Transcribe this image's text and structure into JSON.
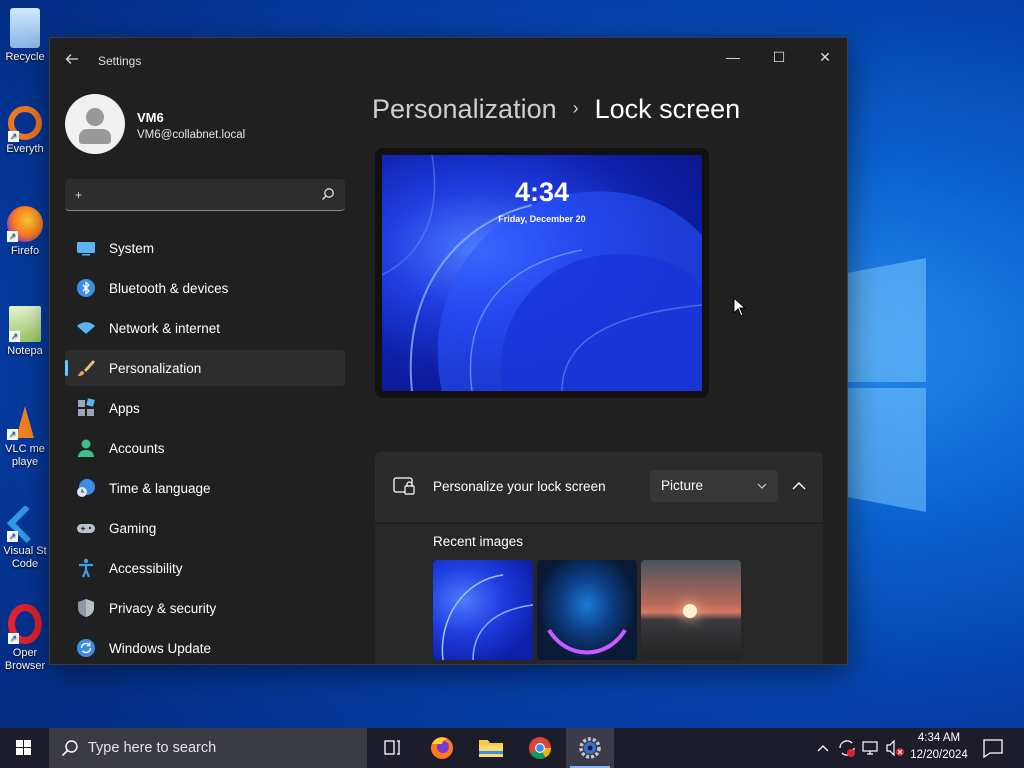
{
  "desktop": {
    "icons": [
      {
        "label": "Recycle"
      },
      {
        "label": "Everyth"
      },
      {
        "label": "Firefo"
      },
      {
        "label": "Notepa"
      },
      {
        "label": "VLC me"
      },
      {
        "label": "playe"
      },
      {
        "label": "Visual St"
      },
      {
        "label": "Code"
      },
      {
        "label": "Oper"
      },
      {
        "label": "Browser"
      }
    ]
  },
  "window": {
    "title": "Settings",
    "controls": {
      "minimize": "—",
      "maximize": "☐",
      "close": "✕"
    }
  },
  "profile": {
    "name": "VM6",
    "email": "VM6@collabnet.local"
  },
  "search": {
    "value": "+"
  },
  "nav": {
    "items": [
      {
        "label": "System",
        "icon": "system-icon"
      },
      {
        "label": "Bluetooth & devices",
        "icon": "bluetooth-icon"
      },
      {
        "label": "Network & internet",
        "icon": "wifi-icon"
      },
      {
        "label": "Personalization",
        "icon": "brush-icon",
        "active": true
      },
      {
        "label": "Apps",
        "icon": "apps-icon"
      },
      {
        "label": "Accounts",
        "icon": "person-icon"
      },
      {
        "label": "Time & language",
        "icon": "clock-globe-icon"
      },
      {
        "label": "Gaming",
        "icon": "gamepad-icon"
      },
      {
        "label": "Accessibility",
        "icon": "accessibility-icon"
      },
      {
        "label": "Privacy & security",
        "icon": "shield-icon"
      },
      {
        "label": "Windows Update",
        "icon": "update-icon"
      }
    ]
  },
  "main": {
    "breadcrumb_parent": "Personalization",
    "breadcrumb_sep": "›",
    "breadcrumb_current": "Lock screen",
    "preview": {
      "time": "4:34",
      "date": "Friday, December 20"
    },
    "personalize": {
      "label": "Personalize your lock screen",
      "selected": "Picture"
    },
    "recent_images_label": "Recent images"
  },
  "taskbar": {
    "search_placeholder": "Type here to search",
    "time": "4:34 AM",
    "date": "12/20/2024"
  },
  "colors": {
    "accent": "#60cdff",
    "window_bg": "#202020",
    "card_bg": "#2b2b2b"
  }
}
